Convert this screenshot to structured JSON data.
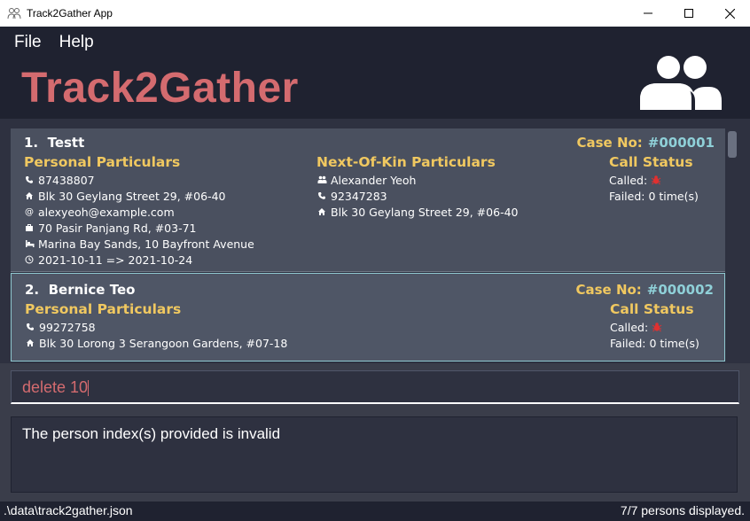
{
  "window": {
    "title": "Track2Gather App"
  },
  "menu": {
    "file": "File",
    "help": "Help"
  },
  "header": {
    "brand": "Track2Gather"
  },
  "persons": [
    {
      "index": "1.",
      "name": "Testt",
      "case_label": "Case No:",
      "case_no": "#000001",
      "personal_title": "Personal Particulars",
      "phone": "87438807",
      "home": "Blk 30 Geylang Street 29, #06-40",
      "email": "alexyeoh@example.com",
      "work": "70 Pasir Panjang Rd, #03-71",
      "quarantine": "Marina Bay Sands, 10 Bayfront Avenue",
      "period": "2021-10-11 => 2021-10-24",
      "nok_title": "Next-Of-Kin Particulars",
      "nok_name": "Alexander Yeoh",
      "nok_phone": "92347283",
      "nok_address": "Blk 30 Geylang Street 29, #06-40",
      "call_title": "Call Status",
      "called_label": "Called:",
      "failed": "Failed: 0 time(s)"
    },
    {
      "index": "2.",
      "name": "Bernice Teo",
      "case_label": "Case No:",
      "case_no": "#000002",
      "personal_title": "Personal Particulars",
      "phone": "99272758",
      "home": "Blk 30 Lorong 3 Serangoon Gardens, #07-18",
      "call_title": "Call Status",
      "called_label": "Called:",
      "failed": "Failed: 0 time(s)"
    }
  ],
  "command": {
    "value": "delete 10"
  },
  "result": {
    "message": "The person index(s) provided is invalid"
  },
  "status": {
    "path": ".\\data\\track2gather.json",
    "count": "7/7 persons displayed."
  },
  "colors": {
    "brand": "#d46b6f",
    "section": "#f0c860",
    "case_number": "#8fd0d8",
    "not_called": "#e03030"
  },
  "icons": [
    "phone-icon",
    "home-icon",
    "at-icon",
    "briefcase-icon",
    "bed-icon",
    "clock-icon",
    "people-icon",
    "bug-icon"
  ]
}
